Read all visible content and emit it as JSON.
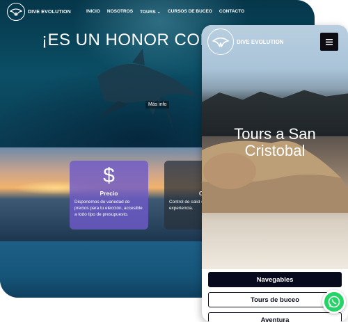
{
  "desktop": {
    "logo_text": "DIVE EVOLUTION",
    "menu": [
      "INICIO",
      "NOSOTROS",
      "TOURS",
      "CURSOS DE BUCEO",
      "CONTACTO"
    ],
    "hero_title": "¡ES UN HONOR CON",
    "hero_button": "Más info",
    "cards": [
      {
        "icon": "dollar-icon",
        "icon_glyph": "$",
        "title": "Precio",
        "text": "Disponemos de variedad de precios para tu elección, accesible a todo tipo de presupuesto."
      },
      {
        "icon": "quality-icon",
        "icon_glyph": "",
        "title": "Cal",
        "text": "Control de calid servicio para bri experiencia."
      }
    ]
  },
  "mobile": {
    "logo_text": "DIVE EVOLUTION",
    "menu_icon": "hamburger-icon",
    "hero_title_line1": "Tours a San",
    "hero_title_line2": "Cristobal",
    "buttons": [
      "Navegables",
      "Tours de buceo",
      "Aventura"
    ]
  },
  "whatsapp_icon": "whatsapp-icon",
  "colors": {
    "primary_button": "#070a1c",
    "precio_card": "#6e5ac8",
    "whatsapp": "#25d366"
  }
}
